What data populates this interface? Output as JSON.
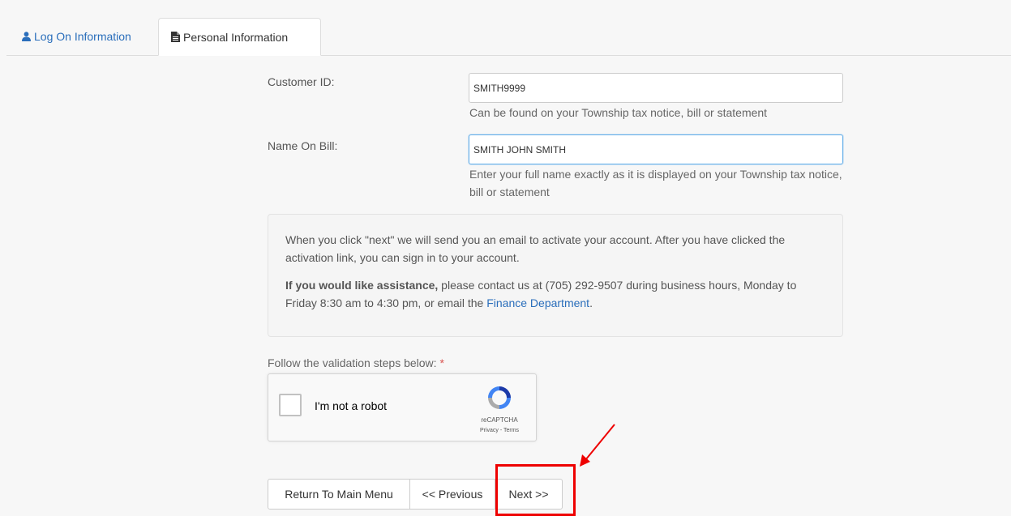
{
  "tabs": [
    {
      "label": "Log On Information",
      "icon": "user-icon"
    },
    {
      "label": "Personal Information",
      "icon": "document-icon"
    }
  ],
  "form": {
    "customer_id": {
      "label": "Customer ID:",
      "value": "SMITH9999",
      "help": "Can be found on your Township tax notice, bill or statement"
    },
    "name_on_bill": {
      "label": "Name On Bill:",
      "value": "SMITH JOHN SMITH",
      "help": "Enter your full name exactly as it is displayed on your Township tax notice, bill or statement"
    }
  },
  "info": {
    "p1": "When you click \"next\" we will send you an email to activate your account. After you have clicked the activation link, you can sign in to your account.",
    "p2_bold": "If you would like assistance,",
    "p2_text": " please contact us at (705) 292-9507 during business hours, Monday to Friday 8:30 am to 4:30 pm, or email the ",
    "p2_link": "Finance Department",
    "p2_end": "."
  },
  "validation": {
    "label": "Follow the validation steps below:",
    "required_mark": "*"
  },
  "captcha": {
    "label": "I'm not a robot",
    "brand": "reCAPTCHA",
    "terms": "Privacy - Terms"
  },
  "buttons": {
    "return": "Return To Main Menu",
    "previous": "<< Previous",
    "next": "Next >>"
  },
  "colors": {
    "link": "#2a6ebb",
    "annotation": "#ee0000"
  }
}
